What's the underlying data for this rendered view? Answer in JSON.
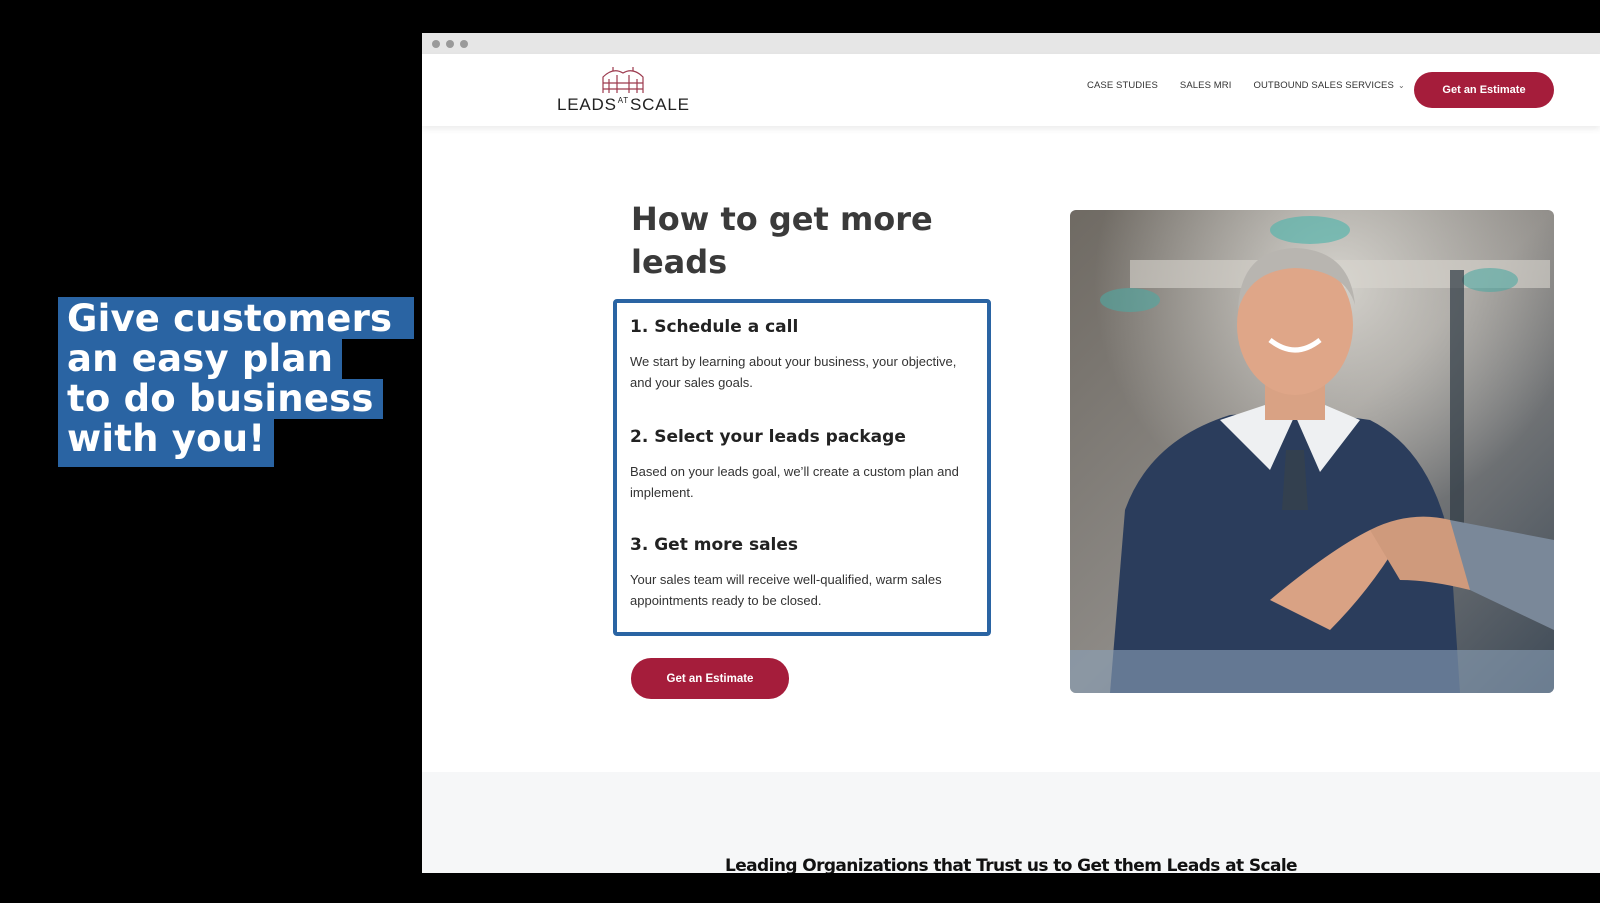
{
  "promo": {
    "lines": [
      "Give customers",
      "an easy plan",
      "to do business",
      "with you!"
    ],
    "background_color": "#2a64a3"
  },
  "site": {
    "logo": {
      "brand": "LEADS",
      "at": "AT",
      "scale": "SCALE"
    },
    "nav": [
      {
        "label": "CASE STUDIES"
      },
      {
        "label": "SALES MRI"
      },
      {
        "label": "OUTBOUND SALES SERVICES",
        "dropdown": true
      }
    ],
    "header_cta": "Get an Estimate",
    "accent_color": "#a51d3b"
  },
  "hero": {
    "title": "How to get more leads",
    "steps": [
      {
        "title": "1. Schedule a call",
        "text": "We start by learning about your business, your objective, and your sales goals."
      },
      {
        "title": "2. Select your leads package",
        "text": "Based on your leads goal, we’ll create a custom plan and implement."
      },
      {
        "title": "3. Get more sales",
        "text": "Your sales team will receive well-qualified, warm sales appointments ready to be closed."
      }
    ],
    "cta": "Get an Estimate",
    "border_color": "#2a64a3"
  },
  "trust": {
    "title": "Leading Organizations that Trust us to Get them Leads at Scale"
  }
}
